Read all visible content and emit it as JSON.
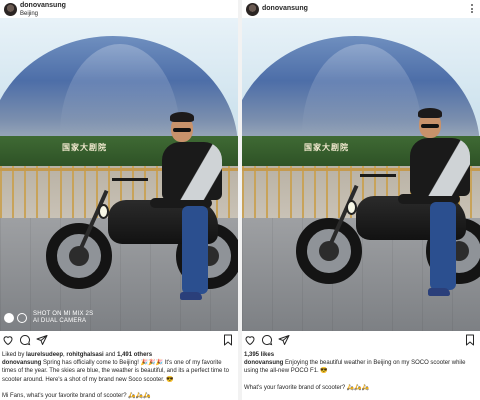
{
  "left_post": {
    "username": "donovansung",
    "location": "Beijing",
    "photo_sign": "国家大剧院",
    "watermark_line1": "SHOT ON MI MIX 2S",
    "watermark_line2": "AI DUAL CAMERA",
    "liked_prefix": "Liked by ",
    "liked_user": "laurelsudeep",
    "liked_comma": ", ",
    "liked_user2": "rohitghalsasi",
    "liked_and": " and ",
    "liked_count": "1,491 others",
    "caption_user": "donovansung",
    "caption_text": " Spring has officially come to Beijing! 🎉🎉🎉 It's one of my favorite times of the year. The skies are blue, the weather is beautiful, and its a perfect time to scooter around. Here's a shot of my brand new Soco scooter. 😎",
    "question": "Mi Fans, what's your favorite brand of scooter? 🛵🛵🛵"
  },
  "right_post": {
    "username": "donovansung",
    "photo_sign": "国家大剧院",
    "likes": "1,395 likes",
    "caption_user": "donovansung",
    "caption_text": " Enjoying the beautiful weather in Beijing on my SOCO scooter while using the all-new POCO F1. 😎",
    "question": "What's your favorite brand of scooter? 🛵🛵🛵"
  },
  "icons": {
    "more": "more-vertical-icon",
    "like": "heart-icon",
    "comment": "comment-icon",
    "share": "send-icon",
    "save": "bookmark-icon"
  },
  "colors": {
    "text": "#262626",
    "link_blue": "#003569"
  }
}
